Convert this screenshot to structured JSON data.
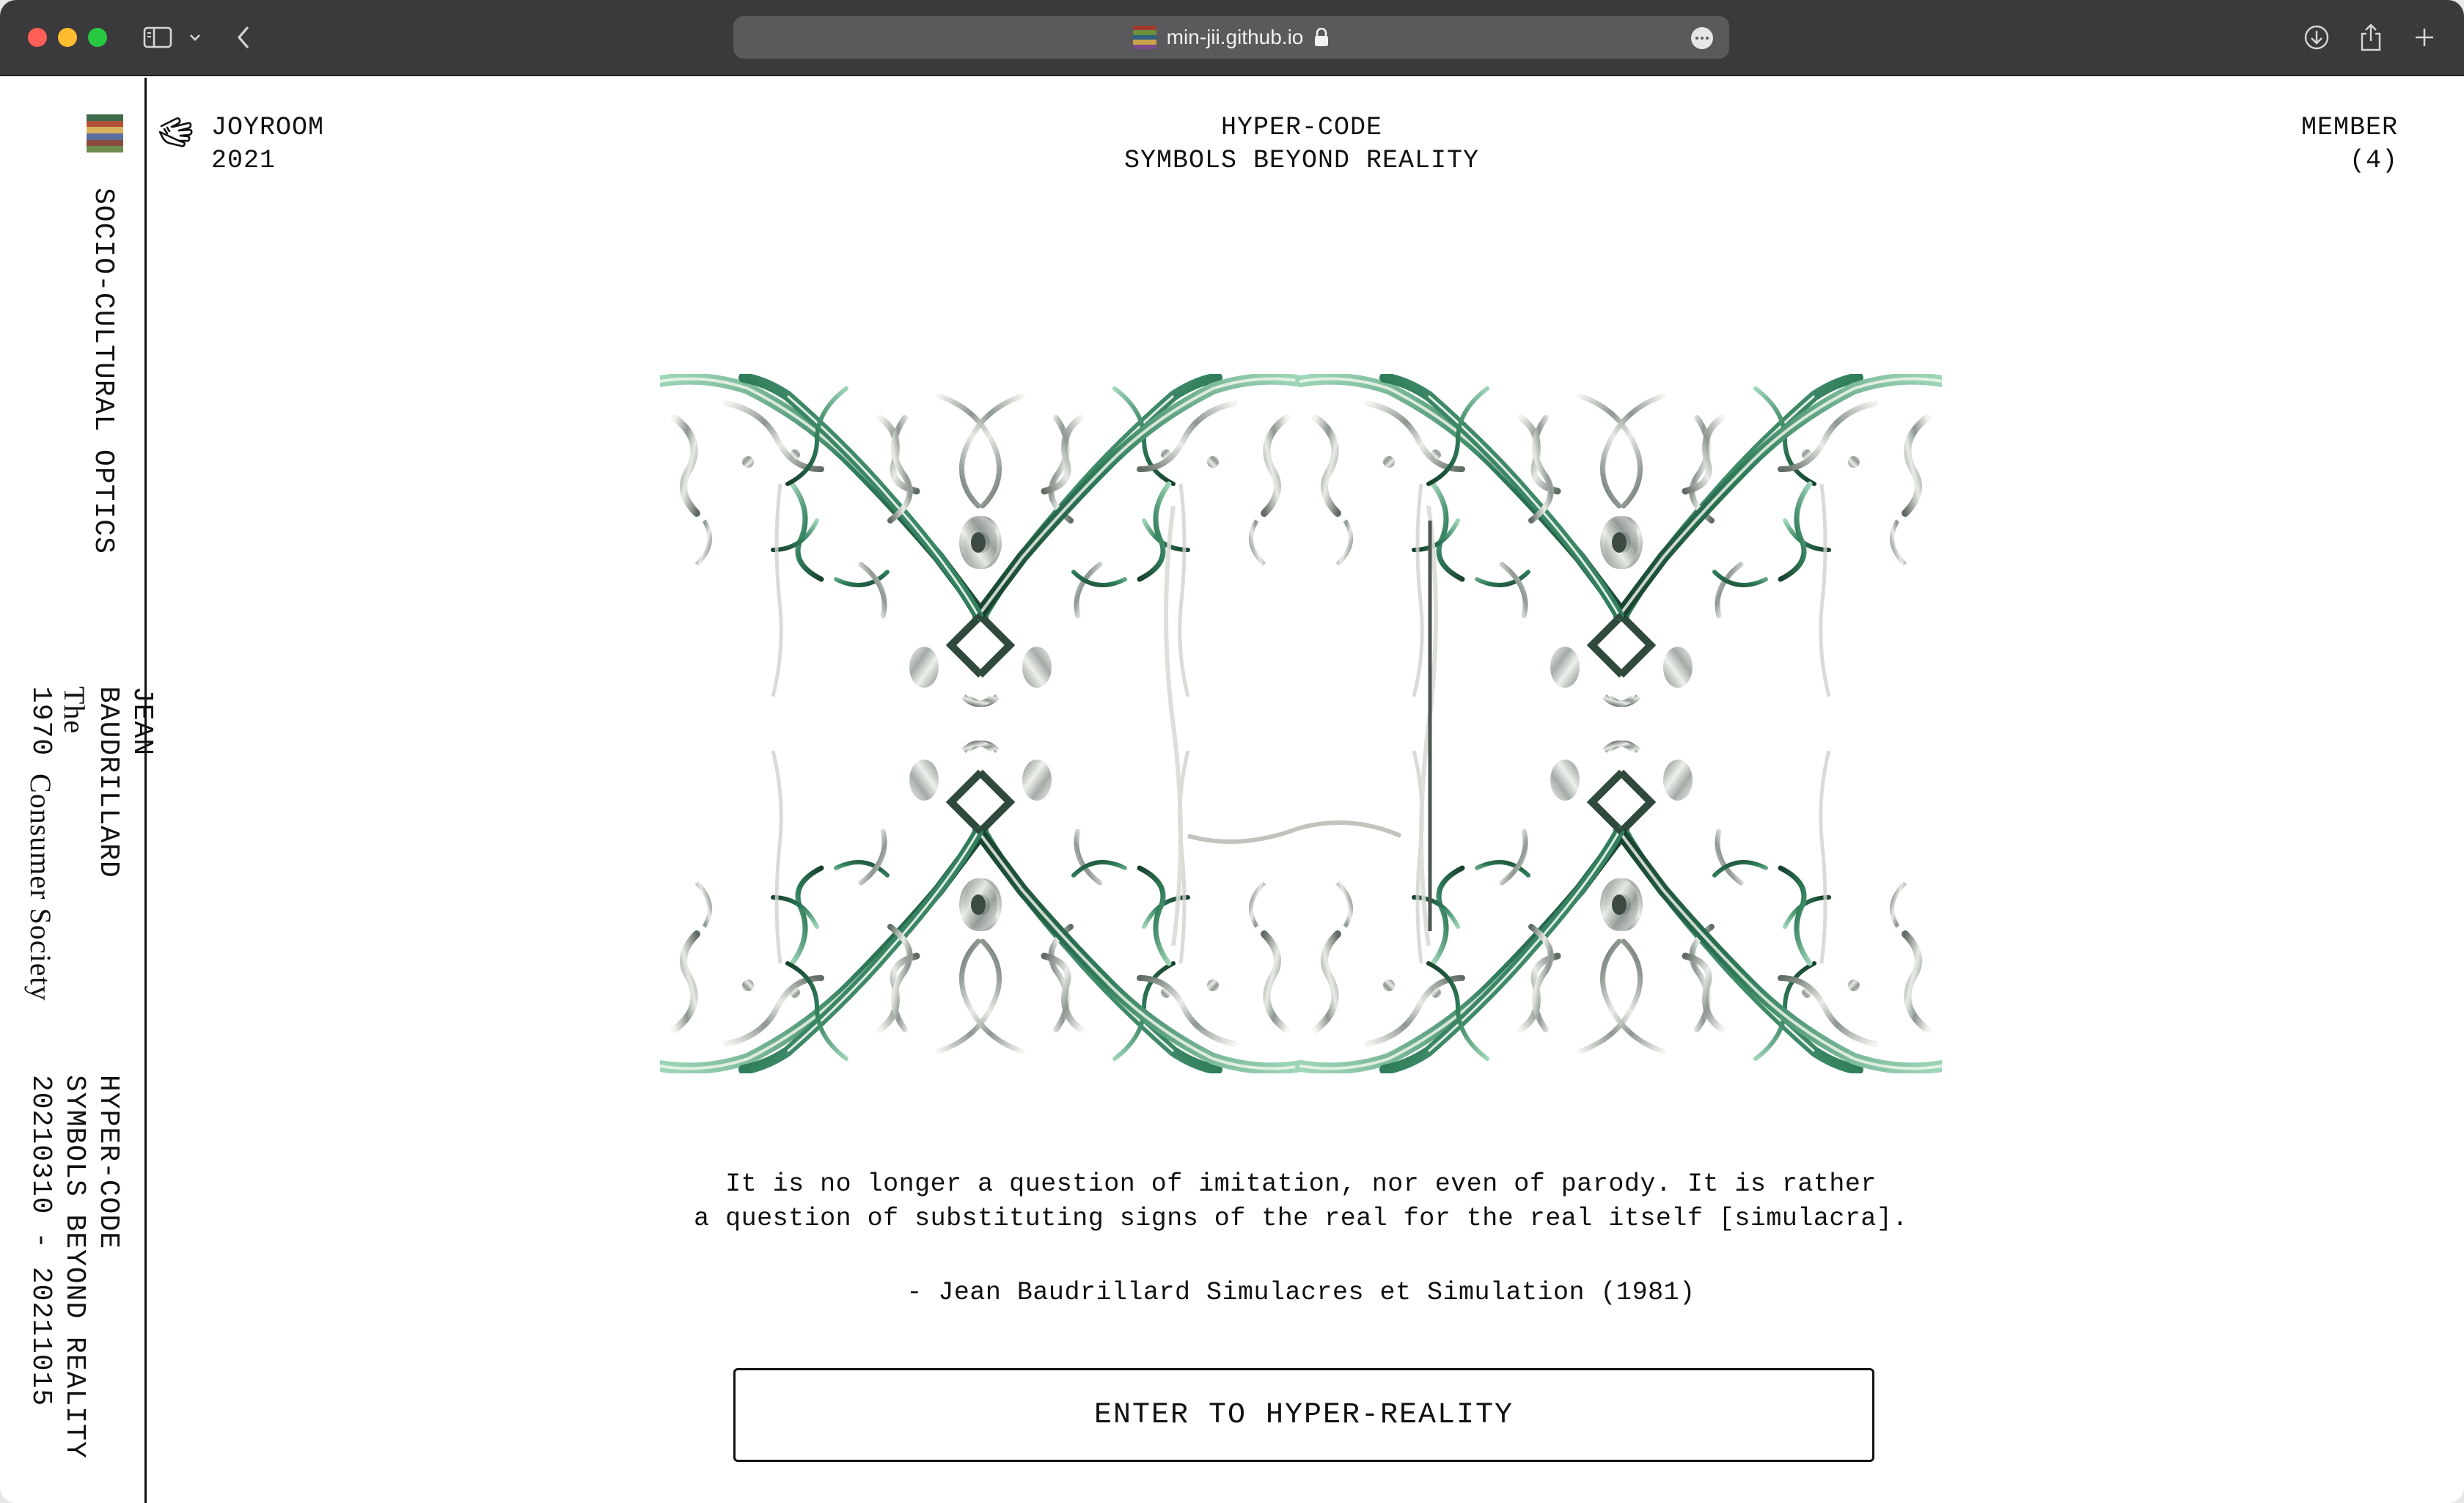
{
  "browser": {
    "url": "min-jii.github.io",
    "favicon_colors": [
      "#a23a2c",
      "#6b8f3a",
      "#2f5f7d",
      "#c9a24a",
      "#7a4a8a"
    ]
  },
  "rail": {
    "logo_colors": [
      "#3f6b4a",
      "#b35238",
      "#d9b25e",
      "#5b6fa0",
      "#8a4b3c",
      "#6d8c4d"
    ],
    "section": "SOCIO-CULTURAL OPTICS",
    "author": "JEAN\nBAUDRILLARD",
    "book_title": "The",
    "book_title_2": "Consumer Society",
    "year": "1970",
    "exhibit_title": "HYPER-CODE\nSYMBOLS BEYOND REALITY",
    "exhibit_dates": "20210310 - 20211015"
  },
  "header": {
    "org": "JOYROOM",
    "year": "2021",
    "title": "HYPER-CODE",
    "subtitle": "SYMBOLS BEYOND REALITY",
    "member_label": "MEMBER",
    "member_count": "(4)"
  },
  "main": {
    "quote_line1": "It is no longer a question of imitation, nor even of parody. It is rather",
    "quote_line2": "a question of substituting signs of the real for the real itself [simulacra].",
    "attribution": "- Jean Baudrillard Simulacres et Simulation (1981)",
    "enter_label": "ENTER TO HYPER-REALITY"
  },
  "colors": {
    "accent_green": "#2f7d5a",
    "chrome": "#3a3a3c",
    "ink": "#111111"
  }
}
